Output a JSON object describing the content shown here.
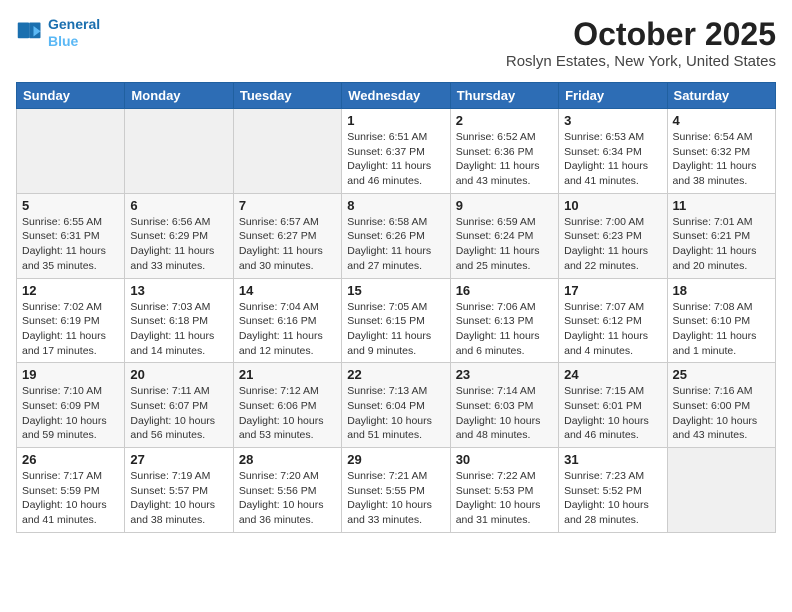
{
  "header": {
    "logo_line1": "General",
    "logo_line2": "Blue",
    "month_title": "October 2025",
    "location": "Roslyn Estates, New York, United States"
  },
  "days_of_week": [
    "Sunday",
    "Monday",
    "Tuesday",
    "Wednesday",
    "Thursday",
    "Friday",
    "Saturday"
  ],
  "weeks": [
    [
      {
        "day": "",
        "info": ""
      },
      {
        "day": "",
        "info": ""
      },
      {
        "day": "",
        "info": ""
      },
      {
        "day": "1",
        "info": "Sunrise: 6:51 AM\nSunset: 6:37 PM\nDaylight: 11 hours\nand 46 minutes."
      },
      {
        "day": "2",
        "info": "Sunrise: 6:52 AM\nSunset: 6:36 PM\nDaylight: 11 hours\nand 43 minutes."
      },
      {
        "day": "3",
        "info": "Sunrise: 6:53 AM\nSunset: 6:34 PM\nDaylight: 11 hours\nand 41 minutes."
      },
      {
        "day": "4",
        "info": "Sunrise: 6:54 AM\nSunset: 6:32 PM\nDaylight: 11 hours\nand 38 minutes."
      }
    ],
    [
      {
        "day": "5",
        "info": "Sunrise: 6:55 AM\nSunset: 6:31 PM\nDaylight: 11 hours\nand 35 minutes."
      },
      {
        "day": "6",
        "info": "Sunrise: 6:56 AM\nSunset: 6:29 PM\nDaylight: 11 hours\nand 33 minutes."
      },
      {
        "day": "7",
        "info": "Sunrise: 6:57 AM\nSunset: 6:27 PM\nDaylight: 11 hours\nand 30 minutes."
      },
      {
        "day": "8",
        "info": "Sunrise: 6:58 AM\nSunset: 6:26 PM\nDaylight: 11 hours\nand 27 minutes."
      },
      {
        "day": "9",
        "info": "Sunrise: 6:59 AM\nSunset: 6:24 PM\nDaylight: 11 hours\nand 25 minutes."
      },
      {
        "day": "10",
        "info": "Sunrise: 7:00 AM\nSunset: 6:23 PM\nDaylight: 11 hours\nand 22 minutes."
      },
      {
        "day": "11",
        "info": "Sunrise: 7:01 AM\nSunset: 6:21 PM\nDaylight: 11 hours\nand 20 minutes."
      }
    ],
    [
      {
        "day": "12",
        "info": "Sunrise: 7:02 AM\nSunset: 6:19 PM\nDaylight: 11 hours\nand 17 minutes."
      },
      {
        "day": "13",
        "info": "Sunrise: 7:03 AM\nSunset: 6:18 PM\nDaylight: 11 hours\nand 14 minutes."
      },
      {
        "day": "14",
        "info": "Sunrise: 7:04 AM\nSunset: 6:16 PM\nDaylight: 11 hours\nand 12 minutes."
      },
      {
        "day": "15",
        "info": "Sunrise: 7:05 AM\nSunset: 6:15 PM\nDaylight: 11 hours\nand 9 minutes."
      },
      {
        "day": "16",
        "info": "Sunrise: 7:06 AM\nSunset: 6:13 PM\nDaylight: 11 hours\nand 6 minutes."
      },
      {
        "day": "17",
        "info": "Sunrise: 7:07 AM\nSunset: 6:12 PM\nDaylight: 11 hours\nand 4 minutes."
      },
      {
        "day": "18",
        "info": "Sunrise: 7:08 AM\nSunset: 6:10 PM\nDaylight: 11 hours\nand 1 minute."
      }
    ],
    [
      {
        "day": "19",
        "info": "Sunrise: 7:10 AM\nSunset: 6:09 PM\nDaylight: 10 hours\nand 59 minutes."
      },
      {
        "day": "20",
        "info": "Sunrise: 7:11 AM\nSunset: 6:07 PM\nDaylight: 10 hours\nand 56 minutes."
      },
      {
        "day": "21",
        "info": "Sunrise: 7:12 AM\nSunset: 6:06 PM\nDaylight: 10 hours\nand 53 minutes."
      },
      {
        "day": "22",
        "info": "Sunrise: 7:13 AM\nSunset: 6:04 PM\nDaylight: 10 hours\nand 51 minutes."
      },
      {
        "day": "23",
        "info": "Sunrise: 7:14 AM\nSunset: 6:03 PM\nDaylight: 10 hours\nand 48 minutes."
      },
      {
        "day": "24",
        "info": "Sunrise: 7:15 AM\nSunset: 6:01 PM\nDaylight: 10 hours\nand 46 minutes."
      },
      {
        "day": "25",
        "info": "Sunrise: 7:16 AM\nSunset: 6:00 PM\nDaylight: 10 hours\nand 43 minutes."
      }
    ],
    [
      {
        "day": "26",
        "info": "Sunrise: 7:17 AM\nSunset: 5:59 PM\nDaylight: 10 hours\nand 41 minutes."
      },
      {
        "day": "27",
        "info": "Sunrise: 7:19 AM\nSunset: 5:57 PM\nDaylight: 10 hours\nand 38 minutes."
      },
      {
        "day": "28",
        "info": "Sunrise: 7:20 AM\nSunset: 5:56 PM\nDaylight: 10 hours\nand 36 minutes."
      },
      {
        "day": "29",
        "info": "Sunrise: 7:21 AM\nSunset: 5:55 PM\nDaylight: 10 hours\nand 33 minutes."
      },
      {
        "day": "30",
        "info": "Sunrise: 7:22 AM\nSunset: 5:53 PM\nDaylight: 10 hours\nand 31 minutes."
      },
      {
        "day": "31",
        "info": "Sunrise: 7:23 AM\nSunset: 5:52 PM\nDaylight: 10 hours\nand 28 minutes."
      },
      {
        "day": "",
        "info": ""
      }
    ]
  ]
}
